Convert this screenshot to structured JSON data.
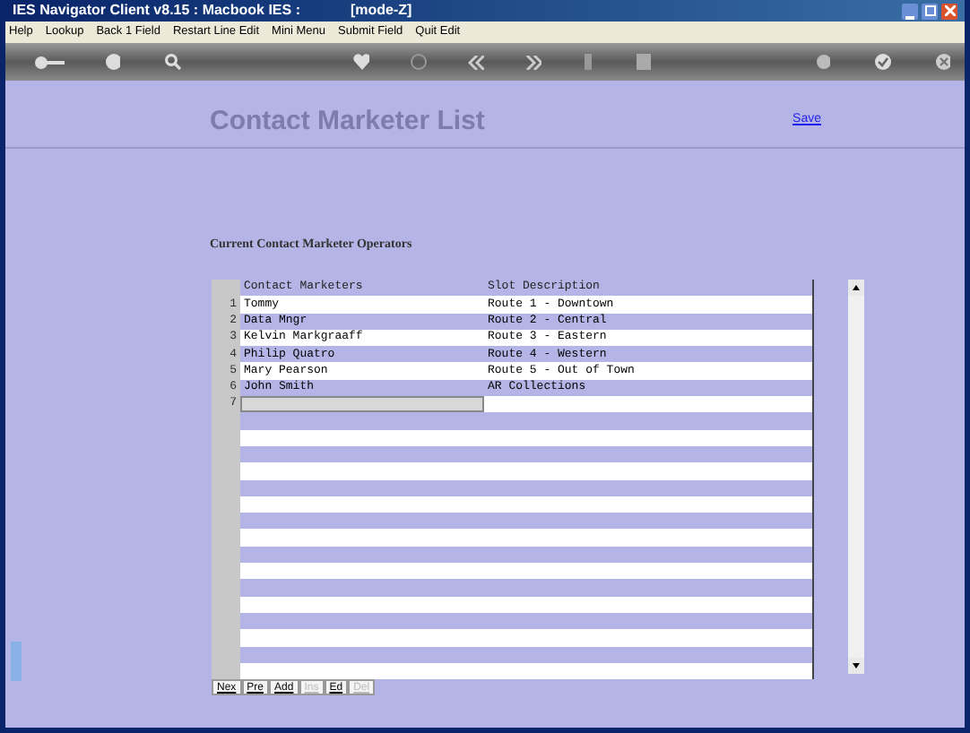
{
  "window": {
    "title": "IES Navigator Client v8.15 : Macbook IES :",
    "mode": "[mode-Z]"
  },
  "menu": [
    "Help",
    "Lookup",
    "Back 1 Field",
    "Restart Line Edit",
    "Mini Menu",
    "Submit Field",
    "Quit Edit"
  ],
  "page": {
    "title": "Contact Marketer List",
    "save_link": "Save",
    "section": "Current Contact Marketer Operators"
  },
  "table": {
    "columns": [
      "Contact Marketers",
      "Slot Description"
    ],
    "rows": [
      {
        "number": "1",
        "marketer": "Tommy",
        "slot": "Route 1 - Downtown"
      },
      {
        "number": "2",
        "marketer": "Data Mngr",
        "slot": "Route 2 - Central"
      },
      {
        "number": "3",
        "marketer": "Kelvin Markgraaff",
        "slot": "Route 3 - Eastern"
      },
      {
        "number": "4",
        "marketer": "Philip Quatro",
        "slot": "Route 4 - Western"
      },
      {
        "number": "5",
        "marketer": "Mary Pearson",
        "slot": "Route 5 - Out of Town"
      },
      {
        "number": "6",
        "marketer": "John Smith",
        "slot": "AR Collections"
      }
    ],
    "entry_row": {
      "number": "7"
    }
  },
  "buttons": [
    {
      "label": "Nex",
      "disabled": false
    },
    {
      "label": "Pre",
      "disabled": false
    },
    {
      "label": "Add",
      "disabled": false
    },
    {
      "label": "Ins",
      "disabled": true
    },
    {
      "label": "Ed",
      "disabled": false
    },
    {
      "label": "Del",
      "disabled": true
    }
  ]
}
